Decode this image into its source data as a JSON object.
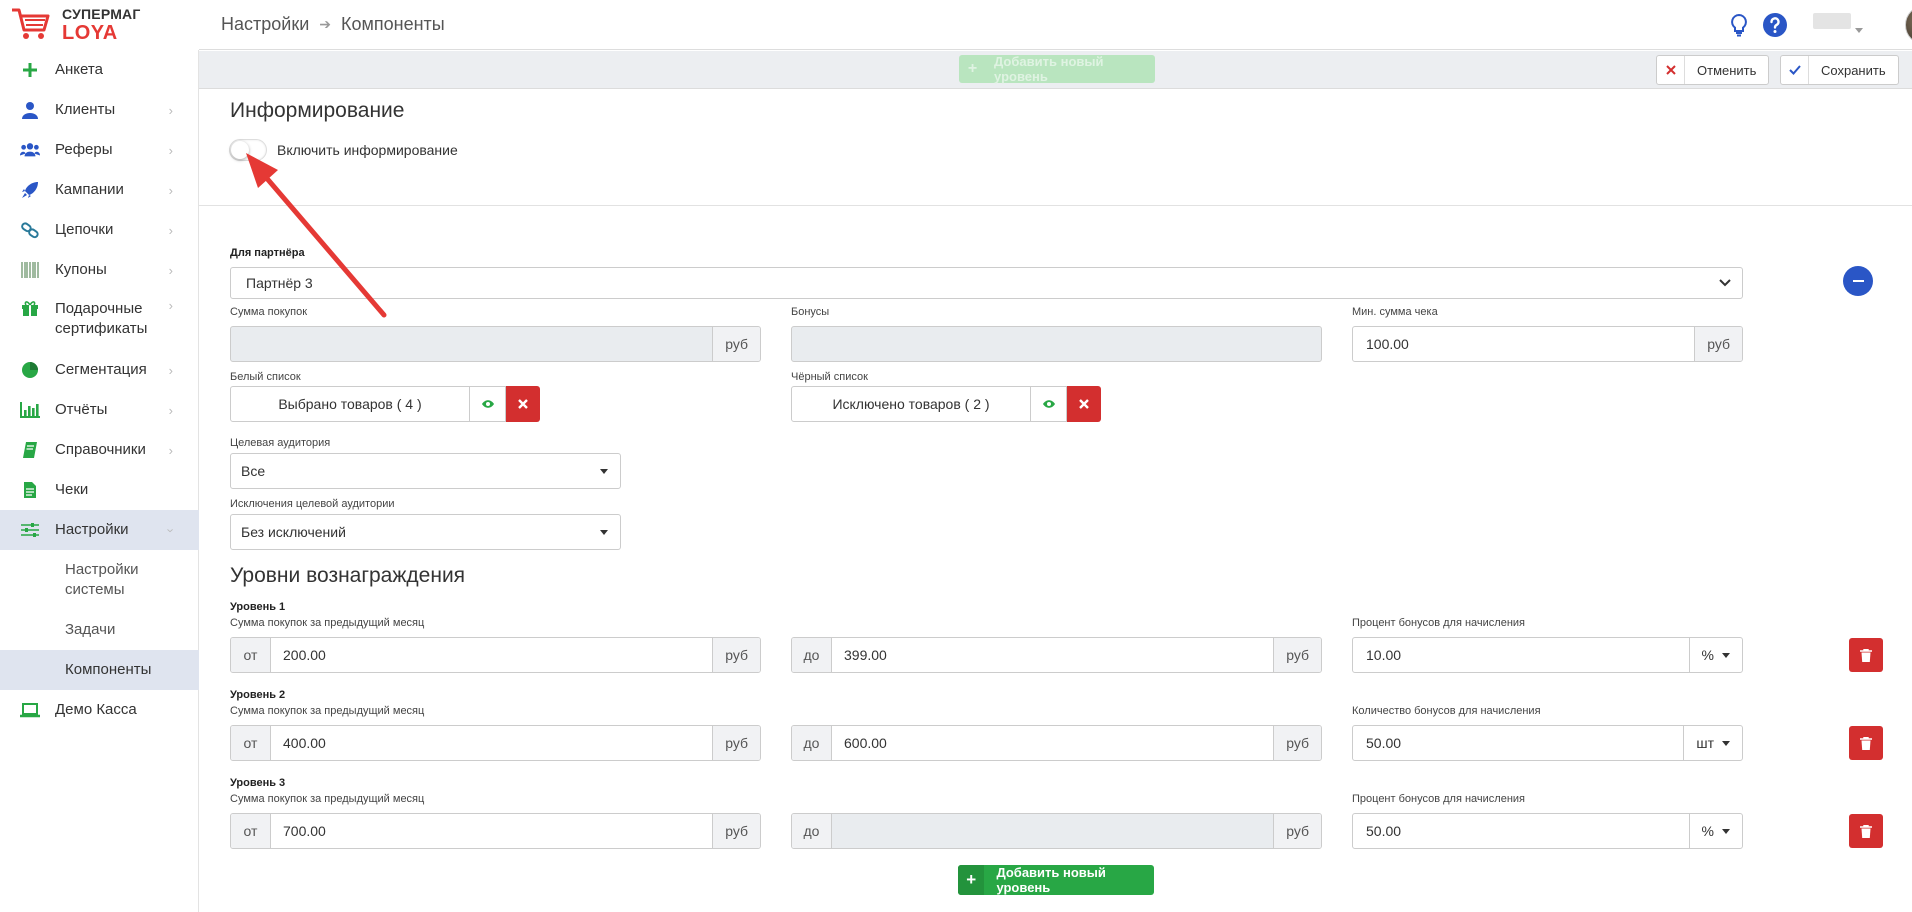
{
  "logo": {
    "line1": "СУПЕРМАГ",
    "line2": "LOYA"
  },
  "header": {
    "breadcrumb": [
      "Настройки",
      "Компоненты"
    ],
    "icons": [
      "lightbulb-icon",
      "help-icon",
      "avatar"
    ]
  },
  "sidebar": {
    "items": [
      {
        "label": "Анкета",
        "icon": "plus-icon"
      },
      {
        "label": "Клиенты",
        "icon": "user-icon"
      },
      {
        "label": "Реферы",
        "icon": "users-icon"
      },
      {
        "label": "Кампании",
        "icon": "rocket-icon"
      },
      {
        "label": "Цепочки",
        "icon": "link-icon"
      },
      {
        "label": "Купоны",
        "icon": "barcode-icon"
      },
      {
        "label": "Подарочные",
        "label2": "сертификаты",
        "icon": "gift-icon"
      },
      {
        "label": "Сегментация",
        "icon": "pie-chart-icon"
      },
      {
        "label": "Отчёты",
        "icon": "bar-chart-icon"
      },
      {
        "label": "Справочники",
        "icon": "book-icon"
      },
      {
        "label": "Чеки",
        "icon": "receipt-icon"
      },
      {
        "label": "Настройки",
        "icon": "sliders-icon"
      },
      {
        "label": "Демо Касса",
        "icon": "laptop-icon"
      }
    ],
    "subitems": [
      {
        "label": "Настройки",
        "label2": "системы"
      },
      {
        "label": "Задачи"
      },
      {
        "label": "Компоненты"
      }
    ]
  },
  "toolbar": {
    "add_level_label": "Добавить новый уровень",
    "cancel_label": "Отменить",
    "save_label": "Сохранить"
  },
  "informing": {
    "title": "Информирование",
    "toggle_label": "Включить информирование",
    "toggle_on": false
  },
  "partner": {
    "label": "Для партнёра",
    "value": "Партнёр 3",
    "sum_label": "Сумма покупок",
    "sum_value": "",
    "sum_unit": "руб",
    "bonus_label": "Бонусы",
    "bonus_value": "",
    "min_label": "Мин. сумма чека",
    "min_value": "100.00",
    "min_unit": "руб",
    "white_label": "Белый список",
    "white_value": "Выбрано товаров ( 4 )",
    "black_label": "Чёрный список",
    "black_value": "Исключено товаров ( 2 )",
    "audience_label": "Целевая аудитория",
    "audience_value": "Все",
    "exclusions_label": "Исключения целевой аудитории",
    "exclusions_value": "Без исключений"
  },
  "levels": {
    "title": "Уровни вознаграждения",
    "from_prefix": "от",
    "to_prefix": "до",
    "unit": "руб",
    "items": [
      {
        "name": "Уровень 1",
        "sum_label": "Сумма покупок за предыдущий месяц",
        "from": "200.00",
        "to": "399.00",
        "bonus_label": "Процент бонусов для начисления",
        "bonus": "10.00",
        "bonus_unit": "%"
      },
      {
        "name": "Уровень 2",
        "sum_label": "Сумма покупок за предыдущий месяц",
        "from": "400.00",
        "to": "600.00",
        "bonus_label": "Количество бонусов для начисления",
        "bonus": "50.00",
        "bonus_unit": "шт"
      },
      {
        "name": "Уровень 3",
        "sum_label": "Сумма покупок за предыдущий месяц",
        "from": "700.00",
        "to": "",
        "bonus_label": "Процент бонусов для начисления",
        "bonus": "50.00",
        "bonus_unit": "%"
      }
    ],
    "add_label": "Добавить новый уровень"
  },
  "colors": {
    "accent": "#e53935",
    "success": "#28a745",
    "danger": "#d32f2f",
    "primary": "#2a56c6",
    "active_bg": "#dfe4ef"
  }
}
